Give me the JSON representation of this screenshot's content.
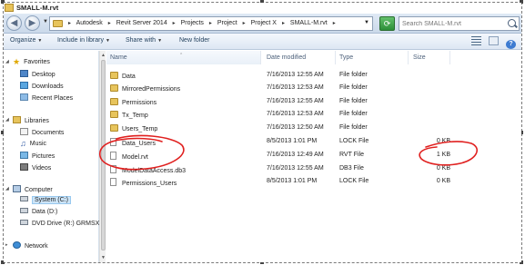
{
  "window": {
    "title": "SMALL-M.rvt"
  },
  "address": {
    "crumbs": [
      "Autodesk",
      "Revit Server 2014",
      "Projects",
      "Project",
      "Project X",
      "SMALL-M.rvt"
    ],
    "search_placeholder": "Search SMALL-M.rvt"
  },
  "toolbar": {
    "organize": "Organize",
    "include_library": "Include in library",
    "share_with": "Share with",
    "new_folder": "New folder"
  },
  "nav": {
    "favorites": "Favorites",
    "desktop": "Desktop",
    "downloads": "Downloads",
    "recent": "Recent Places",
    "libraries": "Libraries",
    "documents": "Documents",
    "music": "Music",
    "pictures": "Pictures",
    "videos": "Videos",
    "computer": "Computer",
    "system_c": "System (C:)",
    "data_d": "Data (D:)",
    "dvd_r": "DVD Drive (R:) GRMSX",
    "network": "Network"
  },
  "columns": {
    "name": "Name",
    "date": "Date modified",
    "type": "Type",
    "size": "Size"
  },
  "files": [
    {
      "name": "Data",
      "date": "7/16/2013 12:55 AM",
      "type": "File folder",
      "size": "",
      "icon": "folder-icon"
    },
    {
      "name": "MirroredPermissions",
      "date": "7/16/2013 12:53 AM",
      "type": "File folder",
      "size": "",
      "icon": "folder-icon"
    },
    {
      "name": "Permissions",
      "date": "7/16/2013 12:55 AM",
      "type": "File folder",
      "size": "",
      "icon": "folder-icon"
    },
    {
      "name": "Tx_Temp",
      "date": "7/16/2013 12:53 AM",
      "type": "File folder",
      "size": "",
      "icon": "folder-icon"
    },
    {
      "name": "Users_Temp",
      "date": "7/16/2013 12:50 AM",
      "type": "File folder",
      "size": "",
      "icon": "folder-icon"
    },
    {
      "name": "Data_Users",
      "date": "8/5/2013 1:01 PM",
      "type": "LOCK File",
      "size": "0 KB",
      "icon": "file-icon"
    },
    {
      "name": "Model.rvt",
      "date": "7/16/2013 12:49 AM",
      "type": "RVT File",
      "size": "1 KB",
      "icon": "file-icon"
    },
    {
      "name": "ModelDataAccess.db3",
      "date": "7/16/2013 12:55 AM",
      "type": "DB3 File",
      "size": "0 KB",
      "icon": "file-icon"
    },
    {
      "name": "Permissions_Users",
      "date": "8/5/2013 1:01 PM",
      "type": "LOCK File",
      "size": "0 KB",
      "icon": "file-icon"
    }
  ],
  "annotation": {
    "color": "#e0201f"
  }
}
